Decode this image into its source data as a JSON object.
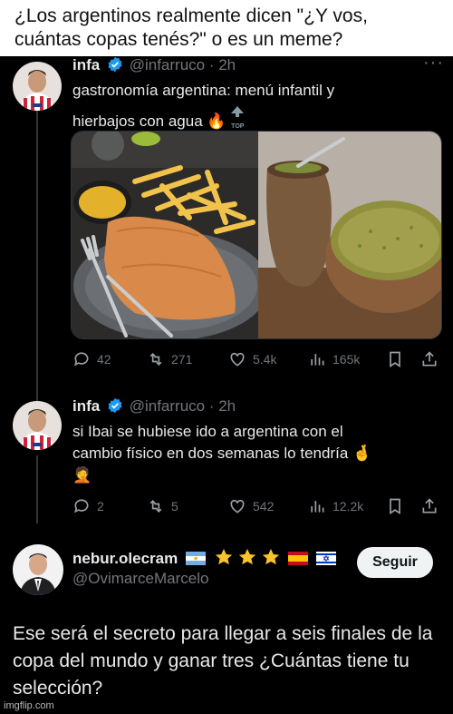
{
  "caption": {
    "line1": "¿Los argentinos realmente dicen \"¿Y vos,",
    "line2": "cuántas copas tenés?\" o es un meme?"
  },
  "tweets": [
    {
      "name": "infa",
      "handle": "@infarruco",
      "time": "· 2h",
      "text_line1": "gastronomía argentina: menú infantil y",
      "text_line2": "hierbajos con agua",
      "emoji": "🔥",
      "top_label": "TOP",
      "replies": "42",
      "retweets": "271",
      "likes": "5.4k",
      "views": "165k"
    },
    {
      "name": "infa",
      "handle": "@infarruco",
      "time": "· 2h",
      "text_line1": "si Ibai se hubiese ido a argentina con el",
      "text_line2": "cambio físico en dos semanas lo tendría",
      "emoji": "🤞",
      "emoji2": "🤦",
      "replies": "2",
      "retweets": "5",
      "likes": "542",
      "views": "12.2k"
    },
    {
      "name": "nebur.olecram",
      "handle": "@OvimarceMarcelo",
      "follow_label": "Seguir",
      "reply_line1": "Ese será el secreto para llegar a seis finales de la",
      "reply_line2": "copa del mundo y ganar tres ¿Cuántas tiene tu",
      "reply_line3": "selección?"
    }
  ],
  "more_glyph": "···",
  "watermark": "imgflip.com",
  "colors": {
    "background": "#000000",
    "text": "#e7e9ea",
    "muted": "#71767b",
    "verified": "#1d9bf0",
    "follow_bg": "#eff3f4"
  },
  "icons": [
    "verified-icon",
    "reply-icon",
    "retweet-icon",
    "like-icon",
    "views-icon",
    "bookmark-icon",
    "share-icon",
    "more-icon"
  ]
}
